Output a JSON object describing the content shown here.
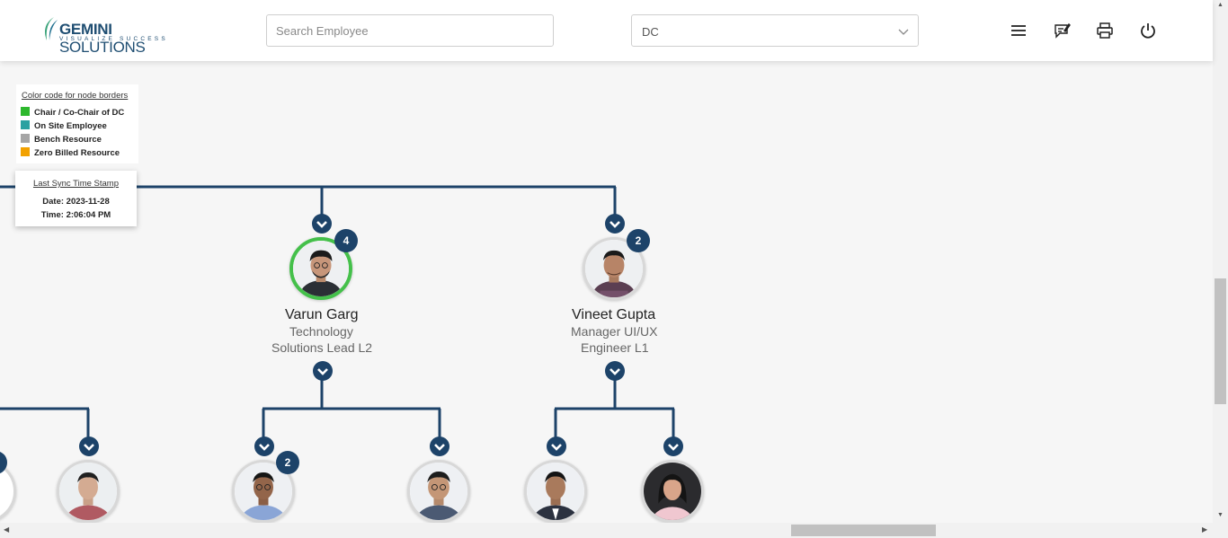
{
  "header": {
    "logo_main_1": "GEMINI",
    "logo_main_2": " SOLUTIONS",
    "logo_tagline": "VISUALIZE SUCCESS",
    "search_placeholder": "Search Employee",
    "dc_select_value": "DC",
    "icons": [
      "menu-icon",
      "feedback-icon",
      "print-icon",
      "power-icon"
    ]
  },
  "legend": {
    "title": "Color code for node borders",
    "items": [
      {
        "label": "Chair / Co-Chair of DC",
        "color": "#2db82d"
      },
      {
        "label": "On Site Employee",
        "color": "#2aa1a1"
      },
      {
        "label": "Bench Resource",
        "color": "#a6a6a6"
      },
      {
        "label": "Zero Billed Resource",
        "color": "#f2a100"
      }
    ]
  },
  "sync": {
    "title": "Last Sync Time Stamp",
    "date": "Date: 2023-11-28",
    "time": "Time: 2:06:04 PM"
  },
  "employees": [
    {
      "name": "Varun Garg",
      "role_line1": "Technology",
      "role_line2": "Solutions Lead L2",
      "reports": "4",
      "border": "chair"
    },
    {
      "name": "Vineet Gupta",
      "role_line1": "Manager UI/UX",
      "role_line2": "Engineer L1",
      "reports": "2",
      "border": "default"
    }
  ],
  "child_badges": {
    "first_child_reports": "2"
  },
  "colors": {
    "connector": "#1d4369",
    "accent": "#1d4369",
    "chair_border": "#44c04a"
  }
}
